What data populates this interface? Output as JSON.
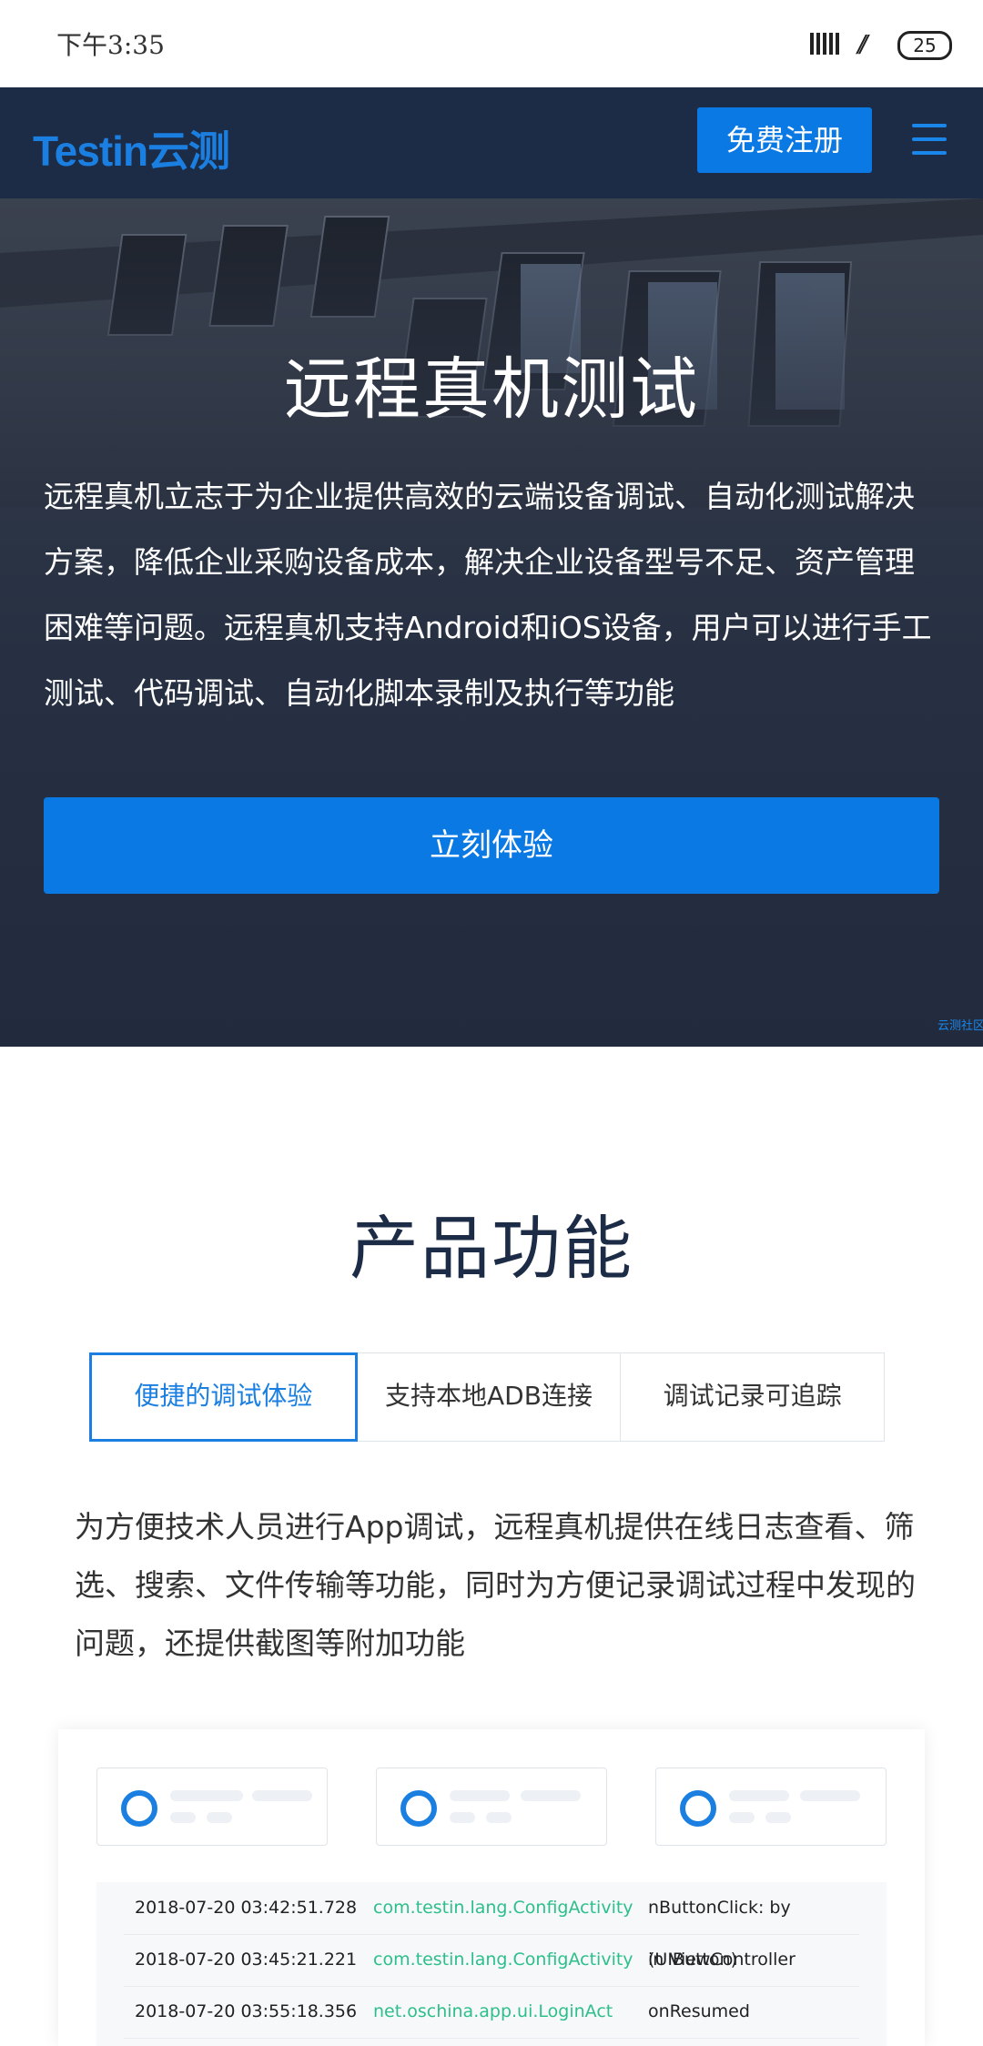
{
  "status_bar": {
    "time": "下午3:35",
    "battery": "25"
  },
  "nav": {
    "logo": "Testin云测",
    "register_label": "免费注册"
  },
  "hero": {
    "title": "远程真机测试",
    "description": "远程真机立志于为企业提供高效的云端设备调试、自动化测试解决方案，降低企业采购设备成本，解决企业设备型号不足、资产管理困难等问题。远程真机支持Android和iOS设备，用户可以进行手工测试、代码调试、自动化脚本录制及执行等功能",
    "cta_label": "立刻体验",
    "corner_tag": "云测社区"
  },
  "features": {
    "title": "产品功能",
    "tabs": [
      {
        "label": "便捷的调试体验",
        "active": true
      },
      {
        "label": "支持本地ADB连接",
        "active": false
      },
      {
        "label": "调试记录可追踪",
        "active": false
      }
    ],
    "description": "为方便技术人员进行App调试，远程真机提供在线日志查看、筛选、搜索、文件传输等功能，同时为方便记录调试过程中发现的问题，还提供截图等附加功能"
  },
  "log_table": {
    "rows": [
      {
        "time": "2018-07-20 03:42:51.728",
        "package": "com.testin.lang.ConfigActivity",
        "message": "nButtonClick: by (UIButton)"
      },
      {
        "time": "2018-07-20 03:45:21.221",
        "package": "com.testin.lang.ConfigActivity",
        "message": "in ViewController"
      },
      {
        "time": "2018-07-20 03:55:18.356",
        "package": "net.oschina.app.ui.LoginAct",
        "message": "onResumed"
      }
    ]
  },
  "colors": {
    "nav_bg": "#1c2b46",
    "accent": "#0b79e4",
    "package_text": "#2cbf8a"
  },
  "icons": {
    "menu": "hamburger-menu-icon",
    "card": "ring-icon"
  }
}
